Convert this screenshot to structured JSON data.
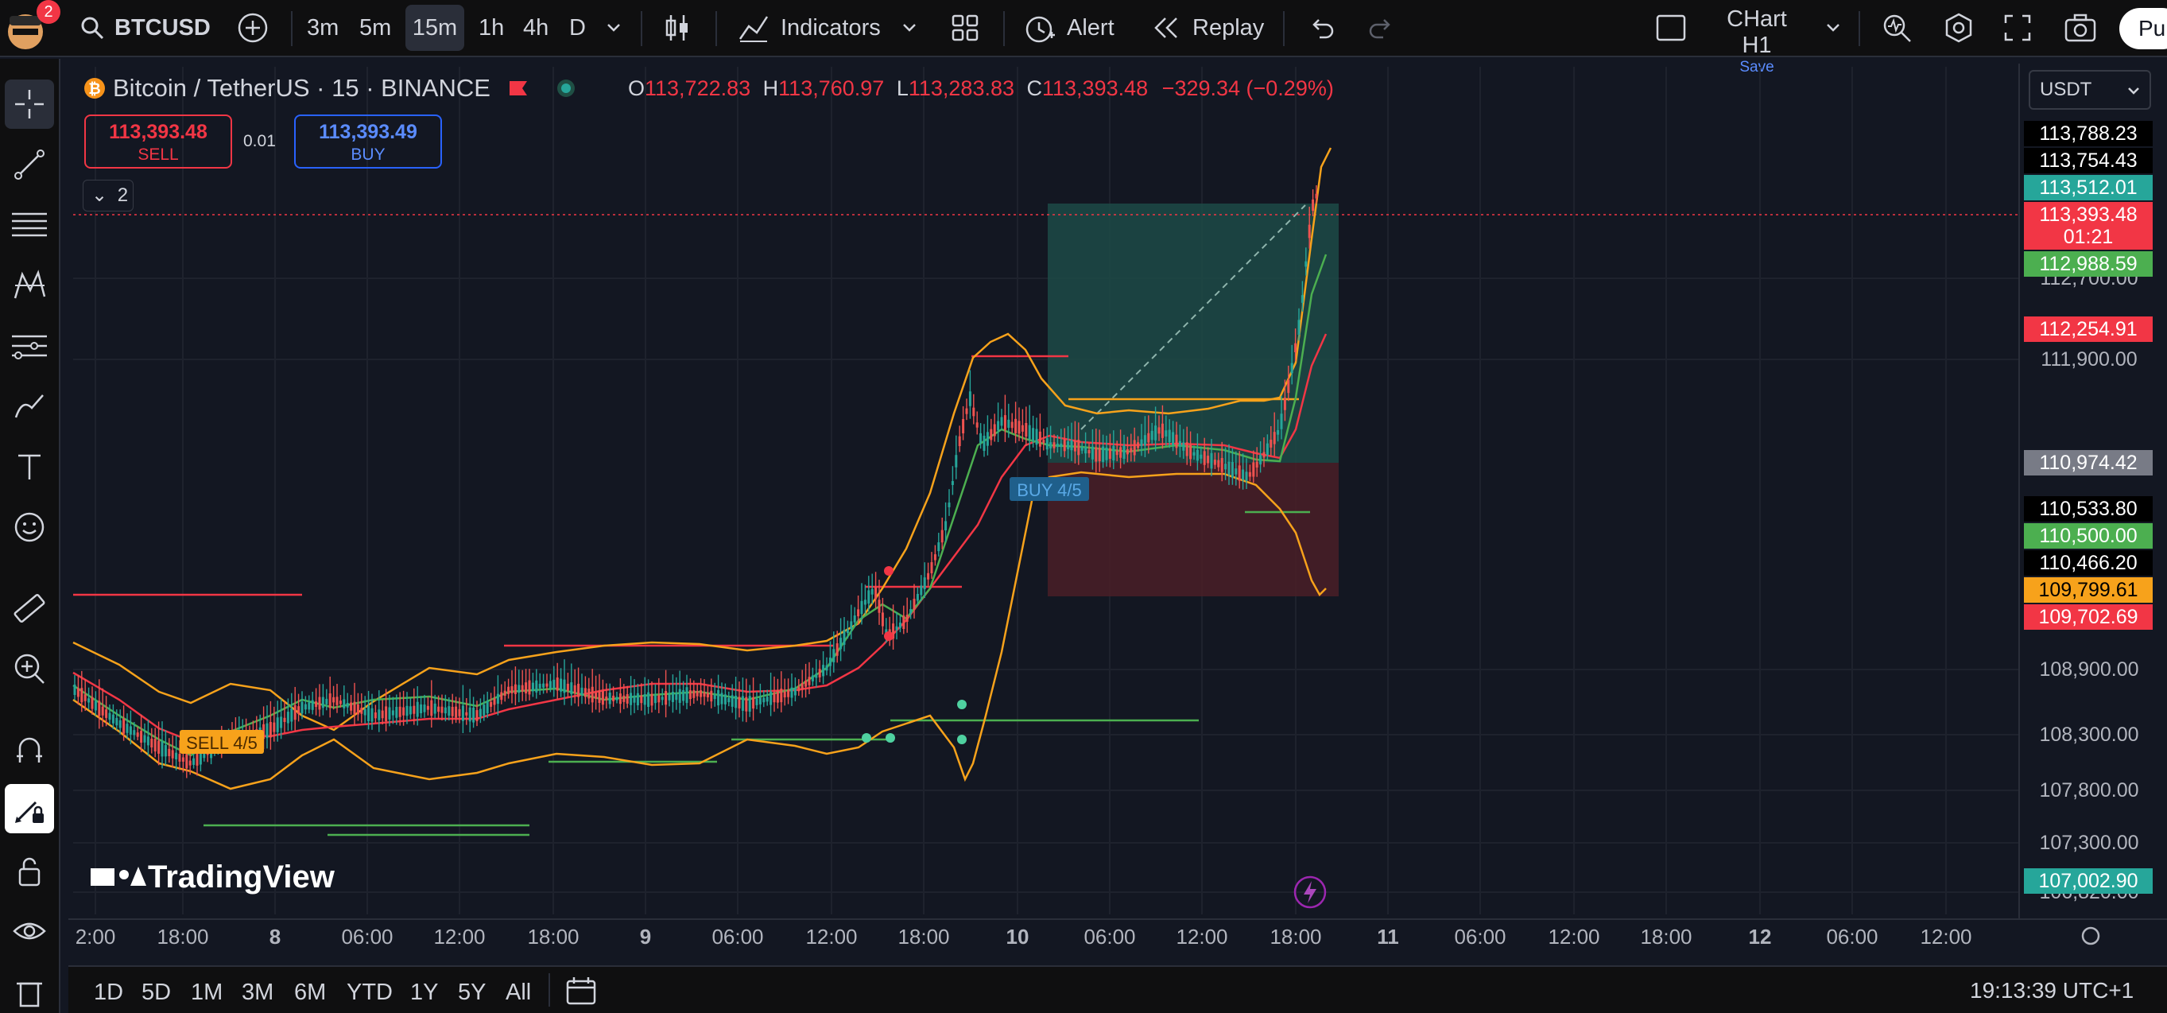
{
  "topbar": {
    "notifications": "2",
    "symbol": "BTCUSD",
    "intervals": [
      "3m",
      "5m",
      "15m",
      "1h",
      "4h",
      "D"
    ],
    "indicators_label": "Indicators",
    "alert_label": "Alert",
    "replay_label": "Replay",
    "layout_name": "CHart H1",
    "layout_save": "Save",
    "publish_label": "Pu"
  },
  "legend": {
    "symbol_title": "Bitcoin / TetherUS · 15 · BINANCE",
    "open_key": "O",
    "open": "113,722.83",
    "high_key": "H",
    "high": "113,760.97",
    "low_key": "L",
    "low": "113,283.83",
    "close_key": "C",
    "close": "113,393.48",
    "change": "−329.34 (−0.29%)",
    "sell_price": "113,393.48",
    "sell_label": "SELL",
    "lot": "0.01",
    "buy_price": "113,393.49",
    "buy_label": "BUY",
    "collapse_count": "2"
  },
  "currency": "USDT",
  "price_labels": [
    {
      "text": "113,788.23",
      "bg": "#000000",
      "fg": "#ffffff"
    },
    {
      "text": "113,754.43",
      "bg": "#000000",
      "fg": "#ffffff"
    },
    {
      "text": "113,512.01",
      "bg": "#26a69a",
      "fg": "#ffffff"
    },
    {
      "text": "113,393.48",
      "bg": "#f23645",
      "fg": "#ffffff"
    },
    {
      "text": "01:21",
      "bg": "#f23645",
      "fg": "#ffffff"
    },
    {
      "text": "112,988.59",
      "bg": "#4caf50",
      "fg": "#ffffff"
    },
    {
      "text": "112,254.91",
      "bg": "#f23645",
      "fg": "#ffffff"
    },
    {
      "text": "110,974.42",
      "bg": "#787b86",
      "fg": "#ffffff"
    },
    {
      "text": "110,533.80",
      "bg": "#000000",
      "fg": "#ffffff"
    },
    {
      "text": "110,500.00",
      "bg": "#4caf50",
      "fg": "#ffffff"
    },
    {
      "text": "110,466.20",
      "bg": "#000000",
      "fg": "#ffffff"
    },
    {
      "text": "109,799.61",
      "bg": "#f7a21b",
      "fg": "#000000"
    },
    {
      "text": "109,702.69",
      "bg": "#f23645",
      "fg": "#ffffff"
    },
    {
      "text": "107,002.90",
      "bg": "#26a69a",
      "fg": "#ffffff"
    }
  ],
  "price_ticks": [
    "112,700.00",
    "111,900.00",
    "108,900.00",
    "108,300.00",
    "107,800.00",
    "107,300.00",
    "106,820.00"
  ],
  "time_ticks": [
    "2:00",
    "18:00",
    "8",
    "06:00",
    "12:00",
    "18:00",
    "9",
    "06:00",
    "12:00",
    "18:00",
    "10",
    "06:00",
    "12:00",
    "18:00",
    "11",
    "06:00",
    "12:00",
    "18:00",
    "12",
    "06:00",
    "12:00"
  ],
  "chart_labels": {
    "buy_marker": "BUY 4/5",
    "sell_marker": "SELL 4/5",
    "watermark": "TradingView"
  },
  "ranges": [
    "1D",
    "5D",
    "1M",
    "3M",
    "6M",
    "YTD",
    "1Y",
    "5Y",
    "All"
  ],
  "clock": "19:13:39 UTC+1",
  "colors": {
    "bg": "#131722",
    "up": "#26a69a",
    "down": "#ef5350",
    "band": "#f7a21b",
    "ma_red": "#f23645",
    "ma_green": "#4caf50"
  }
}
